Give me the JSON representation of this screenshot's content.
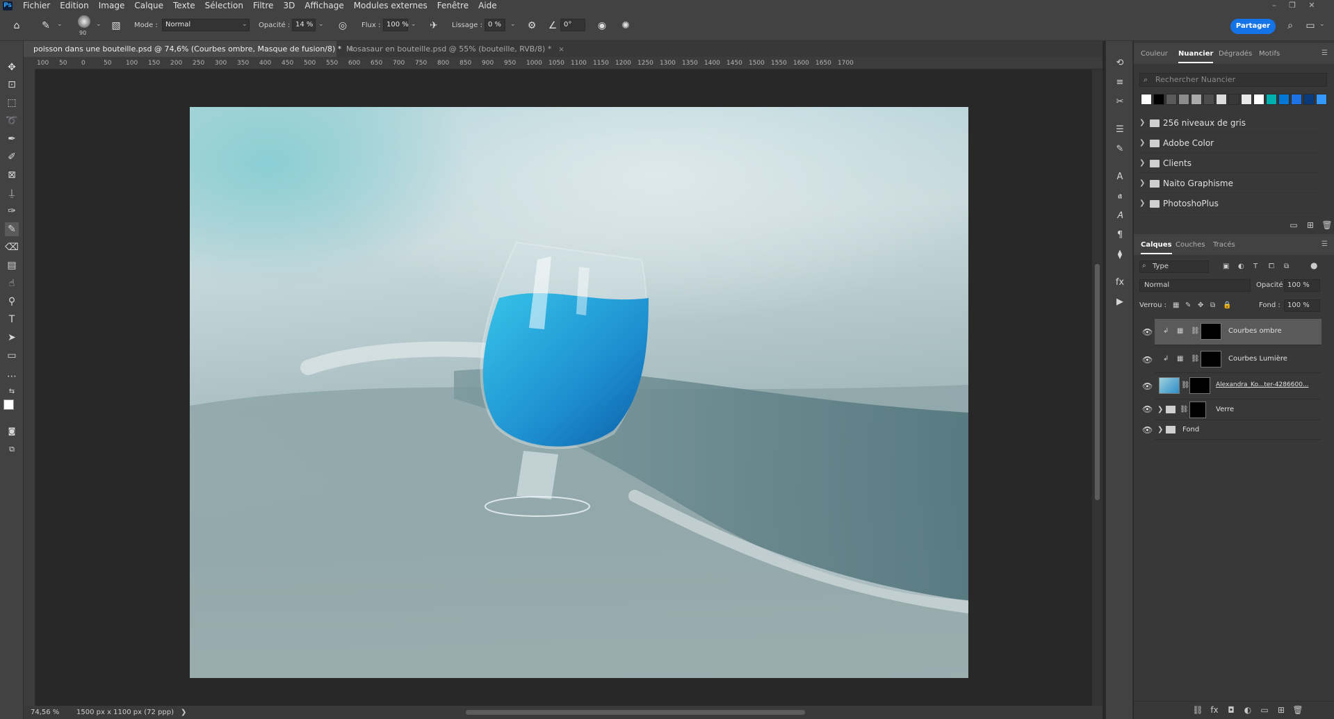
{
  "app": {
    "logo": "Ps"
  },
  "menu": [
    "Fichier",
    "Edition",
    "Image",
    "Calque",
    "Texte",
    "Sélection",
    "Filtre",
    "3D",
    "Affichage",
    "Modules externes",
    "Fenêtre",
    "Aide"
  ],
  "options_bar": {
    "brush_size": "90",
    "mode_label": "Mode :",
    "mode_value": "Normal",
    "opacity_label": "Opacité :",
    "opacity_value": "14 %",
    "flow_label": "Flux :",
    "flow_value": "100 %",
    "smoothing_label": "Lissage :",
    "smoothing_value": "0 %",
    "angle_value": "0°",
    "share_label": "Partager"
  },
  "tabs": [
    {
      "title": "poisson dans une bouteille.psd @ 74,6% (Courbes ombre, Masque de fusion/8) *",
      "close": "×"
    },
    {
      "title": "Mosasaur en bouteille.psd @ 55% (bouteille, RVB/8) *",
      "close": "×"
    }
  ],
  "ruler": {
    "h_ticks": [
      "100",
      "50",
      "0",
      "50",
      "100",
      "150",
      "200",
      "250",
      "300",
      "350",
      "400",
      "450",
      "500",
      "550",
      "600",
      "650",
      "700",
      "750",
      "800",
      "850",
      "900",
      "950",
      "1000",
      "1050",
      "1100",
      "1150",
      "1200",
      "1250",
      "1300",
      "1350",
      "1400",
      "1450",
      "1500",
      "1550",
      "1600",
      "1650",
      "1700"
    ]
  },
  "status": {
    "zoom": "74,56 %",
    "doc_info": "1500 px x 1100 px (72 ppp)",
    "arrow": "❯"
  },
  "color_panel": {
    "tabs": [
      "Couleur",
      "Nuancier",
      "Dégradés",
      "Motifs"
    ],
    "active_tab": "Nuancier",
    "search_placeholder": "Rechercher Nuancier",
    "swatches": [
      "#ffffff",
      "#000000",
      "#5a5a5a",
      "#8c8c8c",
      "#aaaaaa",
      "#4d4d4d",
      "#dcdcdc",
      "#383838",
      "#e8e8e8",
      "#ffffff",
      "#00b0b0",
      "#0078d7",
      "#1e73e6",
      "#0a3a7a",
      "#3399ff",
      "#66b3ff"
    ],
    "groups": [
      "256 niveaux de gris",
      "Adobe Color",
      "Clients",
      "Naito Graphisme",
      "PhotoshoPlus"
    ]
  },
  "layers_panel": {
    "tabs": [
      "Calques",
      "Couches",
      "Tracés"
    ],
    "active_tab": "Calques",
    "filter_value": "Type",
    "blend_mode": "Normal",
    "opacity_label": "Opacité :",
    "opacity_value": "100 %",
    "lock_label": "Verrou :",
    "fill_label": "Fond :",
    "fill_value": "100 %",
    "layers": [
      {
        "name": "Courbes ombre",
        "selected": true
      },
      {
        "name": "Courbes Lumière",
        "selected": false
      },
      {
        "name": "Alexandra_Ko...ter-4286600...",
        "selected": false
      },
      {
        "name": "Verre",
        "selected": false
      },
      {
        "name": "Fond",
        "selected": false
      }
    ]
  },
  "colors": {
    "accent": "#1473e6",
    "water": "#2aa8d8"
  }
}
